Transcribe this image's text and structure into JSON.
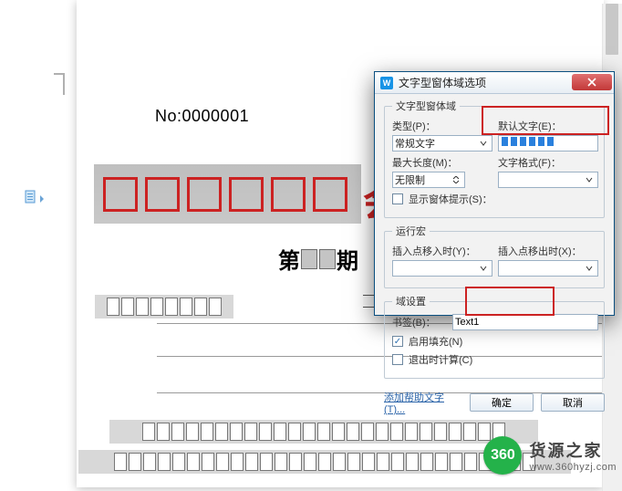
{
  "document": {
    "serial_prefix": "No:",
    "serial_value": "0000001",
    "red_glyph": "会",
    "issue_prefix": "第",
    "issue_suffix": "期"
  },
  "dialog": {
    "title": "文字型窗体域选项",
    "groups": {
      "text_field": {
        "legend": "文字型窗体域",
        "type_label": "类型(P)：",
        "type_value": "常规文字",
        "default_label": "默认文字(E)：",
        "maxlen_label": "最大长度(M)：",
        "maxlen_value": "无限制",
        "format_label": "文字格式(F)：",
        "format_value": ""
      },
      "run_macro": {
        "legend": "运行宏",
        "on_enter_label": "插入点移入时(Y)：",
        "on_exit_label": "插入点移出时(X)："
      },
      "field_settings": {
        "legend": "域设置",
        "bookmark_label": "书签(B)：",
        "bookmark_value": "Text1",
        "fill_enabled_label": "启用填充(N)",
        "fill_enabled": true,
        "calc_on_exit_label": "退出时计算(C)",
        "calc_on_exit": false
      }
    },
    "help_button": "添加帮助文字(T)...",
    "ok": "确定",
    "cancel": "取消"
  },
  "watermark": {
    "badge": "360",
    "cn": "货源之家",
    "url": "www.360hyzj.com"
  }
}
